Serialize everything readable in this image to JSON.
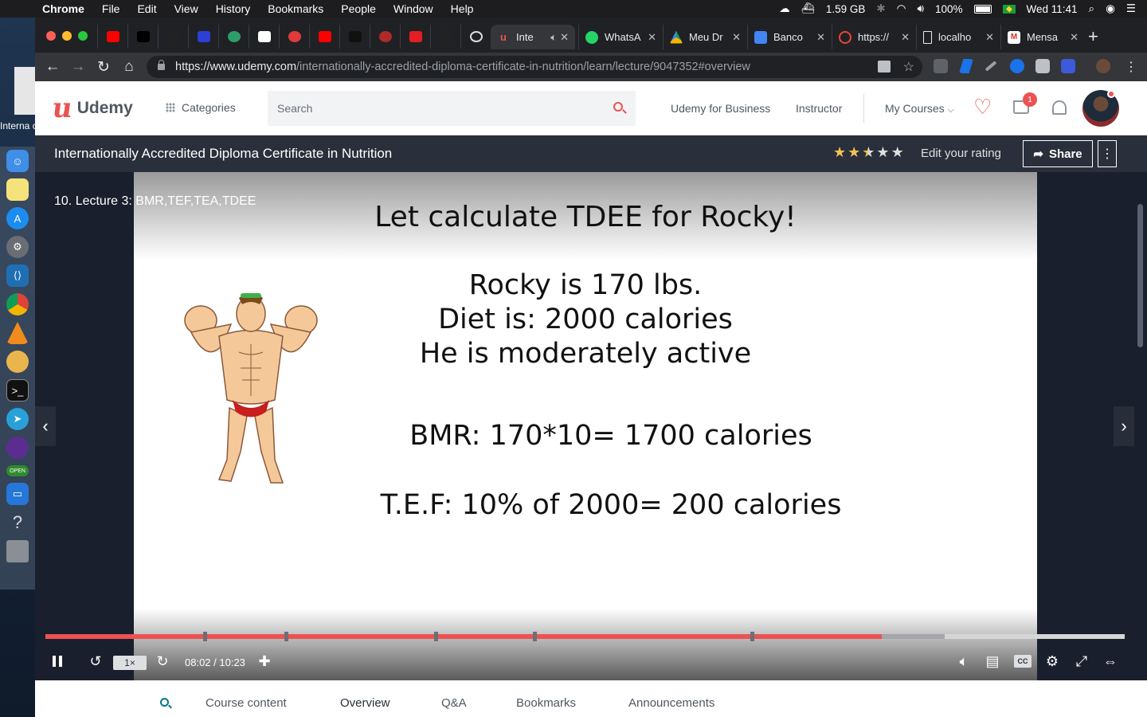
{
  "menubar": {
    "app": "Chrome",
    "items": [
      "File",
      "Edit",
      "View",
      "History",
      "Bookmarks",
      "People",
      "Window",
      "Help"
    ],
    "memory": "1.59 GB",
    "battery": "100%",
    "clock": "Wed 11:41"
  },
  "desktop": {
    "label": "Interna ccredit"
  },
  "tabs": [
    {
      "title": "Inte",
      "favicon": "udemy-icon",
      "active": true
    },
    {
      "title": "WhatsA",
      "favicon": "whatsapp-icon"
    },
    {
      "title": "Meu Dr",
      "favicon": "drive-icon"
    },
    {
      "title": "Banco",
      "favicon": "docs-icon"
    },
    {
      "title": "https://",
      "favicon": "loading-icon"
    },
    {
      "title": "localho",
      "favicon": "page-icon"
    },
    {
      "title": "Mensa",
      "favicon": "gmail-icon"
    }
  ],
  "address": {
    "host": "https://www.udemy.com",
    "path": "/internationally-accredited-diploma-certificate-in-nutrition/learn/lecture/9047352#overview"
  },
  "header": {
    "logo": "Udemy",
    "categories": "Categories",
    "search_placeholder": "Search",
    "udemy_for_business": "Udemy for Business",
    "instructor": "Instructor",
    "my_courses": "My Courses",
    "cart_count": "1"
  },
  "course": {
    "title": "Internationally Accredited Diploma Certificate in Nutrition",
    "rating_stars": 2.5,
    "edit_rating": "Edit your rating",
    "share": "Share"
  },
  "video": {
    "lecture_label": "10. Lecture 3: BMR,TEF,TEA,TDEE",
    "slide_title": "Let calculate TDEE for Rocky!",
    "slide_lines": [
      "Rocky is 170 lbs.",
      "Diet is: 2000 calories",
      "He is moderately active"
    ],
    "bmr_line": "BMR: 170*10= 1700 calories",
    "tef_line": "T.E.F: 10% of 2000= 200 calories",
    "timecode": "08:02 / 10:23",
    "speed": "1×",
    "progress_fraction": 0.775,
    "buffered_fraction": 0.833,
    "cc_label": "CC"
  },
  "bottom_tabs": [
    "Course content",
    "Overview",
    "Q&A",
    "Bookmarks",
    "Announcements"
  ]
}
